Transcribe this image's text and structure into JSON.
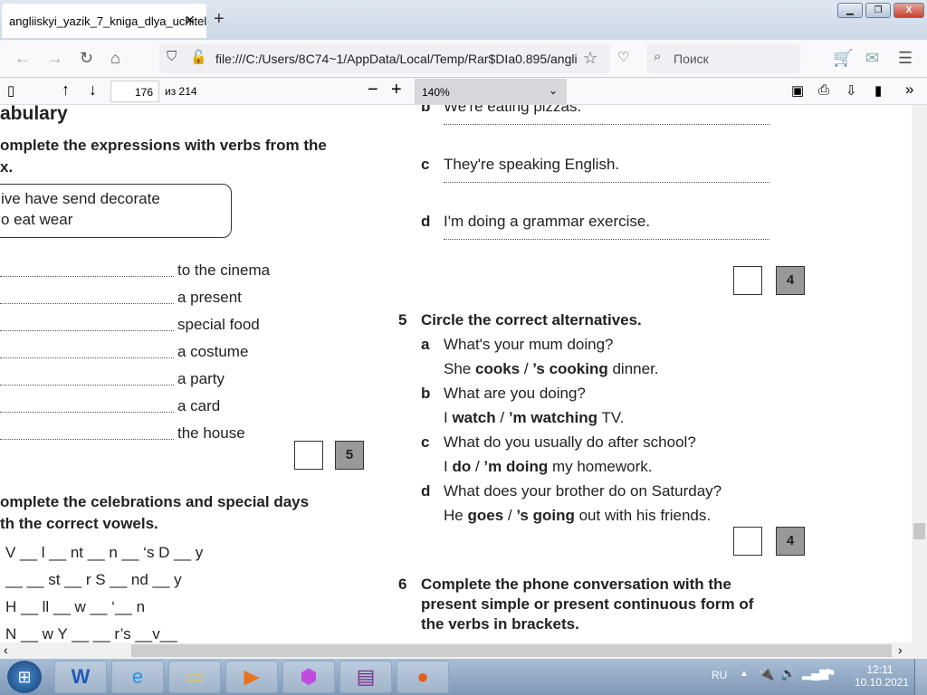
{
  "browser": {
    "tab_title": "angliiskyi_yazik_7_kniga_dlya_uchitel",
    "url": "file:///C:/Users/8C74~1/AppData/Local/Temp/Rar$DIa0.895/angli",
    "search_placeholder": "Поиск"
  },
  "pdf_toolbar": {
    "page": "176",
    "page_total": "из 214",
    "zoom": "140%"
  },
  "left": {
    "heading_cut": "abulary",
    "ex_instruction": [
      "omplete the expressions with verbs from the",
      "x."
    ],
    "word_box": [
      "ive  have  send  decorate",
      "o  eat  wear"
    ],
    "items": [
      "to the cinema",
      "a present",
      "special food",
      "a costume",
      "a party",
      "a card",
      "the house"
    ],
    "score": "5",
    "ex2_instruction": [
      "omplete the celebrations and special days",
      "th the correct vowels."
    ],
    "ex2_items": [
      "V __ l __ nt __ n __ ‘s   D __ y",
      "__ __ st __ r   S __ nd __ y",
      "H __ ll __ w __ ‘__ n",
      "N __ w   Y __ __ r’s   __v__"
    ]
  },
  "right": {
    "items_top": [
      {
        "letter": "b",
        "text": "We're eating pizzas."
      },
      {
        "letter": "c",
        "text": "They're speaking English."
      },
      {
        "letter": "d",
        "text": "I'm doing a grammar exercise."
      }
    ],
    "score1": "4",
    "ex5": {
      "number": "5",
      "title": "Circle the correct alternatives.",
      "items": [
        {
          "letter": "a",
          "q": "What's your mum doing?",
          "pre": "She ",
          "opt1": "cooks",
          "opt2": "’s cooking",
          "post": " dinner."
        },
        {
          "letter": "b",
          "q": "What are you doing?",
          "pre": "I ",
          "opt1": "watch",
          "opt2": "’m watching",
          "post": " TV."
        },
        {
          "letter": "c",
          "q": "What do you usually do after school?",
          "pre": "I ",
          "opt1": "do",
          "opt2": "’m doing",
          "post": " my homework."
        },
        {
          "letter": "d",
          "q": "What does your brother do on Saturday?",
          "pre": "He ",
          "opt1": "goes",
          "opt2": "’s going",
          "post": " out with his friends."
        }
      ]
    },
    "score2": "4",
    "ex6": {
      "number": "6",
      "title": [
        "Complete the phone conversation with the",
        "present simple or present continuous form of",
        "the verbs in brackets."
      ]
    }
  },
  "taskbar": {
    "lang": "RU",
    "time": "12:11",
    "date": "10.10.2021"
  }
}
